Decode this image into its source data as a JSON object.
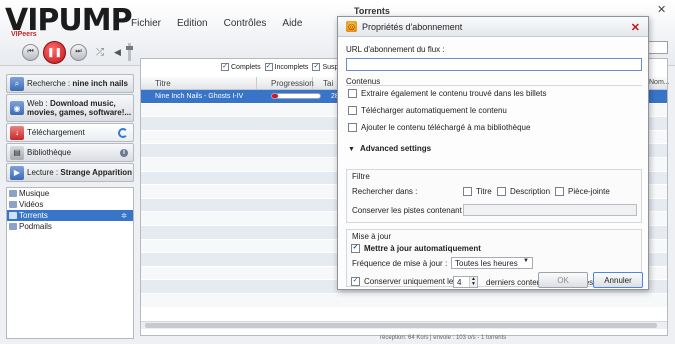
{
  "app": {
    "logo_main": "VIPUMP",
    "logo_sub": "VIPeers",
    "window_title": "Torrents",
    "close_glyph": "✕"
  },
  "menu": [
    "Fichier",
    "Edition",
    "Contrôles",
    "Aide"
  ],
  "nav": {
    "search": {
      "prefix": "Recherche : ",
      "value": "nine inch nails"
    },
    "web": {
      "prefix": "Web : ",
      "value_line1": "Download music,",
      "value_line2": "movies, games, software!..."
    },
    "download": {
      "label": "Téléchargement"
    },
    "library": {
      "label": "Bibliothèque",
      "badge": "i"
    },
    "playing": {
      "prefix": "Lecture : ",
      "value": "Strange Apparition"
    }
  },
  "sublist": [
    {
      "label": "Musique"
    },
    {
      "label": "Vidéos"
    },
    {
      "label": "Torrents",
      "selected": true
    },
    {
      "label": "Podmails"
    }
  ],
  "filters": [
    {
      "label": "Complets",
      "checked": true
    },
    {
      "label": "Incomplets",
      "checked": true
    },
    {
      "label": "Suspen",
      "checked": true
    }
  ],
  "table": {
    "columns": [
      "Titre",
      "Progression",
      "Tai"
    ],
    "right_column": "Nom...",
    "rows": [
      {
        "title": "Nine Inch Nails - Ghosts I-IV",
        "progress": 0.12,
        "size": "283",
        "selected": true
      }
    ]
  },
  "status": "réception: 64 Ko/s | envoie : 103 o/s - 1 torrents",
  "dialog": {
    "title": "Propriétés d'abonnement",
    "url_label": "URL d'abonnement du flux :",
    "url_value": "",
    "contenus": {
      "title": "Contenus",
      "options": [
        {
          "label": "Extraire également le contenu trouvé dans les billets",
          "checked": false
        },
        {
          "label": "Télécharger automatiquement le contenu",
          "checked": false
        },
        {
          "label": "Ajouter le contenu téléchargé à ma bibliothèque",
          "checked": false
        }
      ]
    },
    "advanced": "Advanced settings",
    "filtre": {
      "title": "Filtre",
      "search_in": "Rechercher dans :",
      "fields": [
        {
          "label": "Titre",
          "checked": false
        },
        {
          "label": "Description",
          "checked": false
        },
        {
          "label": "Pièce-jointe",
          "checked": false
        }
      ],
      "keep_label": "Conserver les pistes contenant :",
      "keep_value": ""
    },
    "mise_a_jour": {
      "title": "Mise à jour",
      "auto_label": "Mettre à jour automatiquement",
      "auto_checked": true,
      "freq_label": "Fréquence de mise à jour :",
      "freq_value": "Toutes les heures",
      "keep_label": "Conserver uniquement les",
      "keep_count": "4",
      "keep_suffix": "derniers contenus téléchargés",
      "keep_checked": true
    },
    "ok": "OK",
    "cancel": "Annuler"
  }
}
